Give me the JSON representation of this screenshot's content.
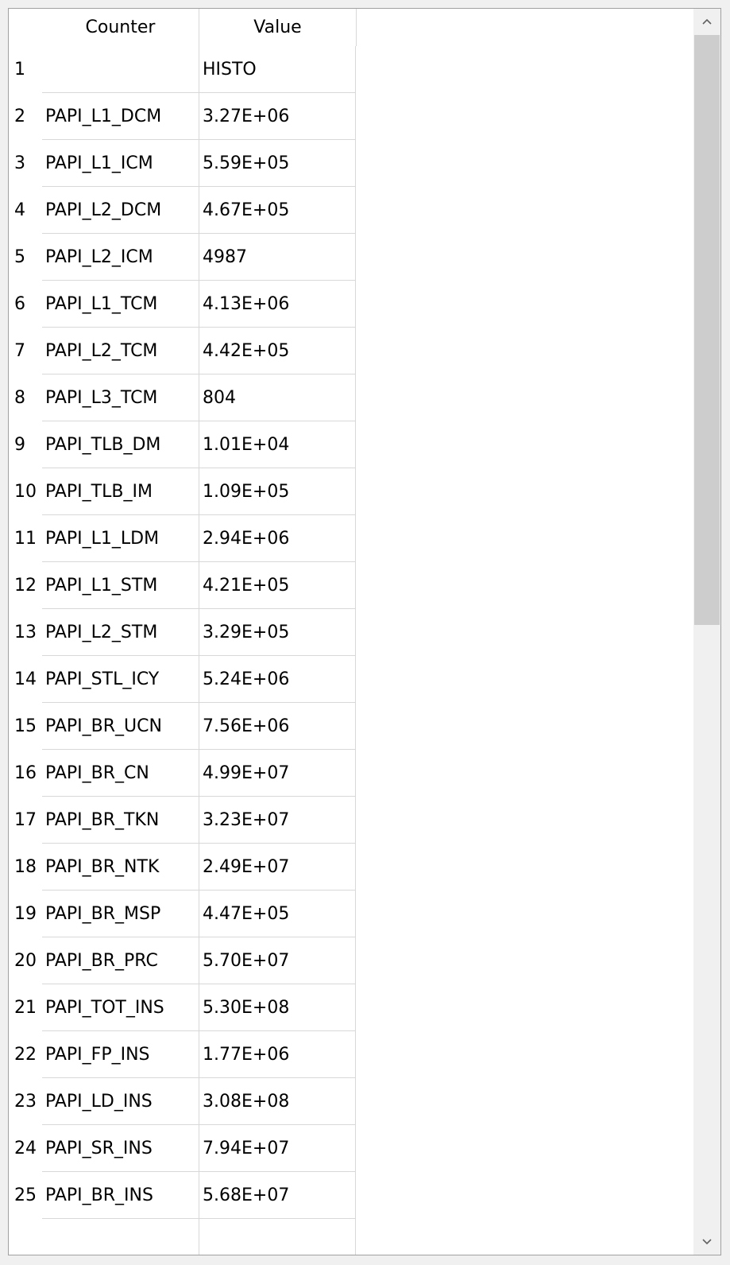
{
  "table": {
    "headers": {
      "counter": "Counter",
      "value": "Value"
    },
    "rows": [
      {
        "num": "1",
        "counter": "",
        "value": "HISTO"
      },
      {
        "num": "2",
        "counter": "PAPI_L1_DCM",
        "value": "3.27E+06"
      },
      {
        "num": "3",
        "counter": "PAPI_L1_ICM",
        "value": "5.59E+05"
      },
      {
        "num": "4",
        "counter": "PAPI_L2_DCM",
        "value": "4.67E+05"
      },
      {
        "num": "5",
        "counter": "PAPI_L2_ICM",
        "value": "4987"
      },
      {
        "num": "6",
        "counter": "PAPI_L1_TCM",
        "value": "4.13E+06"
      },
      {
        "num": "7",
        "counter": "PAPI_L2_TCM",
        "value": "4.42E+05"
      },
      {
        "num": "8",
        "counter": "PAPI_L3_TCM",
        "value": "804"
      },
      {
        "num": "9",
        "counter": "PAPI_TLB_DM",
        "value": "1.01E+04"
      },
      {
        "num": "10",
        "counter": "PAPI_TLB_IM",
        "value": "1.09E+05"
      },
      {
        "num": "11",
        "counter": "PAPI_L1_LDM",
        "value": "2.94E+06"
      },
      {
        "num": "12",
        "counter": "PAPI_L1_STM",
        "value": "4.21E+05"
      },
      {
        "num": "13",
        "counter": "PAPI_L2_STM",
        "value": "3.29E+05"
      },
      {
        "num": "14",
        "counter": "PAPI_STL_ICY",
        "value": "5.24E+06"
      },
      {
        "num": "15",
        "counter": "PAPI_BR_UCN",
        "value": "7.56E+06"
      },
      {
        "num": "16",
        "counter": "PAPI_BR_CN",
        "value": "4.99E+07"
      },
      {
        "num": "17",
        "counter": "PAPI_BR_TKN",
        "value": "3.23E+07"
      },
      {
        "num": "18",
        "counter": "PAPI_BR_NTK",
        "value": "2.49E+07"
      },
      {
        "num": "19",
        "counter": "PAPI_BR_MSP",
        "value": "4.47E+05"
      },
      {
        "num": "20",
        "counter": "PAPI_BR_PRC",
        "value": "5.70E+07"
      },
      {
        "num": "21",
        "counter": "PAPI_TOT_INS",
        "value": "5.30E+08"
      },
      {
        "num": "22",
        "counter": "PAPI_FP_INS",
        "value": "1.77E+06"
      },
      {
        "num": "23",
        "counter": "PAPI_LD_INS",
        "value": "3.08E+08"
      },
      {
        "num": "24",
        "counter": "PAPI_SR_INS",
        "value": "7.94E+07"
      },
      {
        "num": "25",
        "counter": "PAPI_BR_INS",
        "value": "5.68E+07"
      },
      {
        "num": "",
        "counter": "",
        "value": ""
      }
    ]
  },
  "scrollbar": {
    "up_icon": "chevron-up-icon",
    "down_icon": "chevron-down-icon",
    "position": 0
  }
}
